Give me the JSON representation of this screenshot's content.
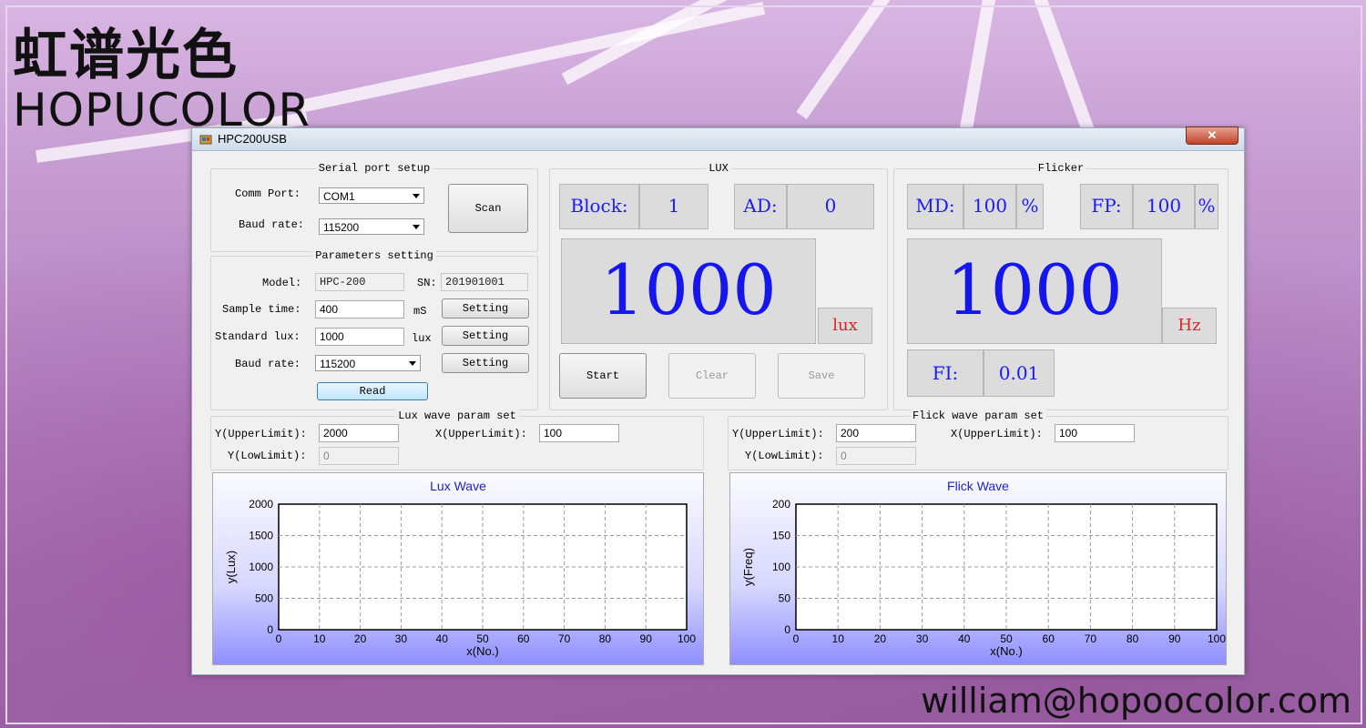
{
  "brand": {
    "cn": "虹谱光色",
    "en": "HOPUCOLOR",
    "email": "william@hopoocolor.com"
  },
  "window": {
    "title": "HPC200USB",
    "close_label": "✕"
  },
  "serial": {
    "title": "Serial port setup",
    "comm_label": "Comm Port:",
    "comm_value": "COM1",
    "baud_label": "Baud rate:",
    "baud_value": "115200",
    "scan_label": "Scan"
  },
  "params": {
    "title": "Parameters setting",
    "model_label": "Model:",
    "model_value": "HPC-200",
    "sn_label": "SN:",
    "sn_value": "201901001",
    "sample_label": "Sample time:",
    "sample_value": "400",
    "sample_unit": "mS",
    "stdlux_label": "Standard lux:",
    "stdlux_value": "1000",
    "stdlux_unit": "lux",
    "baud_label": "Baud rate:",
    "baud_value": "115200",
    "setting_label": "Setting",
    "read_label": "Read"
  },
  "lux": {
    "title": "LUX",
    "block_label": "Block:",
    "block_value": "1",
    "ad_label": "AD:",
    "ad_value": "0",
    "value": "1000",
    "unit": "lux",
    "start_label": "Start",
    "clear_label": "Clear",
    "save_label": "Save"
  },
  "flicker": {
    "title": "Flicker",
    "md_label": "MD:",
    "md_value": "100",
    "md_unit": "%",
    "fp_label": "FP:",
    "fp_value": "100",
    "fp_unit": "%",
    "value": "1000",
    "unit": "Hz",
    "fi_label": "FI:",
    "fi_value": "0.01"
  },
  "lux_wave_param": {
    "title": "Lux wave param set",
    "y_upper_label": "Y(UpperLimit):",
    "y_upper_value": "2000",
    "x_upper_label": "X(UpperLimit):",
    "x_upper_value": "100",
    "y_low_label": "Y(LowLimit):",
    "y_low_value": "0"
  },
  "flick_wave_param": {
    "title": "Flick wave param set",
    "y_upper_label": "Y(UpperLimit):",
    "y_upper_value": "200",
    "x_upper_label": "X(UpperLimit):",
    "x_upper_value": "100",
    "y_low_label": "Y(LowLimit):",
    "y_low_value": "0"
  },
  "chart_data": [
    {
      "type": "line",
      "title": "Lux Wave",
      "xlabel": "x(No.)",
      "ylabel": "y(Lux)",
      "xlim": [
        0,
        100
      ],
      "ylim": [
        0,
        2000
      ],
      "x_ticks": [
        0,
        10,
        20,
        30,
        40,
        50,
        60,
        70,
        80,
        90,
        100
      ],
      "y_ticks": [
        0,
        500,
        1000,
        1500,
        2000
      ],
      "grid": true,
      "series": []
    },
    {
      "type": "line",
      "title": "Flick Wave",
      "xlabel": "x(No.)",
      "ylabel": "y(Freq)",
      "xlim": [
        0,
        100
      ],
      "ylim": [
        0,
        200
      ],
      "x_ticks": [
        0,
        10,
        20,
        30,
        40,
        50,
        60,
        70,
        80,
        90,
        100
      ],
      "y_ticks": [
        0,
        50,
        100,
        150,
        200
      ],
      "grid": true,
      "series": []
    }
  ]
}
